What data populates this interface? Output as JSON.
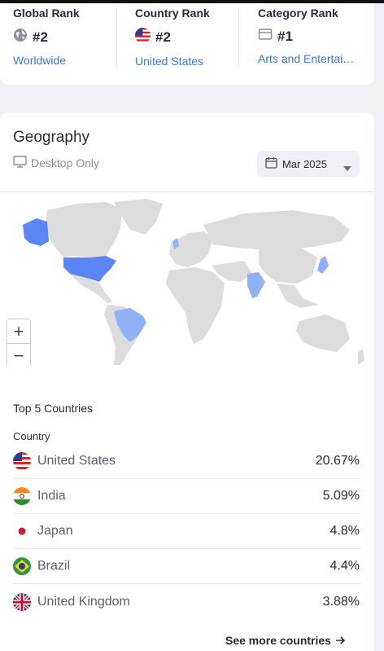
{
  "ranks": {
    "global": {
      "title": "Global Rank",
      "value": "#2",
      "link": "Worldwide",
      "icon": "globe-icon"
    },
    "country": {
      "title": "Country Rank",
      "value": "#2",
      "link": "United States",
      "icon": "us-flag-icon"
    },
    "category": {
      "title": "Category Rank",
      "value": "#1",
      "link": "Arts and Entertai…",
      "icon": "category-icon"
    }
  },
  "geography": {
    "title": "Geography",
    "device_label": "Desktop Only",
    "date_label": "Mar 2025",
    "top5_label": "Top 5 Countries",
    "column_label": "Country",
    "countries": [
      {
        "name": "United States",
        "share": "20.67%",
        "flag": "us-flag-icon"
      },
      {
        "name": "India",
        "share": "5.09%",
        "flag": "india-flag-icon"
      },
      {
        "name": "Japan",
        "share": "4.8%",
        "flag": "japan-flag-icon"
      },
      {
        "name": "Brazil",
        "share": "4.4%",
        "flag": "brazil-flag-icon"
      },
      {
        "name": "United Kingdom",
        "share": "3.88%",
        "flag": "uk-flag-icon"
      }
    ],
    "see_more": "See more countries",
    "zoom_in": "+",
    "zoom_out": "−"
  },
  "colors": {
    "link": "#3e74e0",
    "map_base": "#dcdcdc",
    "map_us": "#5b85f5",
    "map_secondary": "#90b0f7"
  }
}
